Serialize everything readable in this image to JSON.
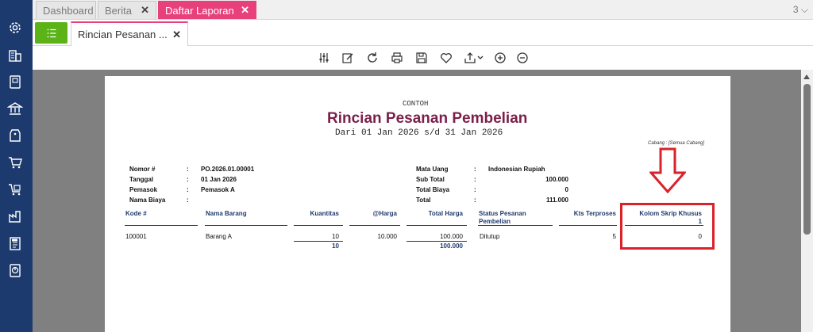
{
  "tabs": [
    {
      "label": "Dashboard",
      "closable": false
    },
    {
      "label": "Berita",
      "closable": true
    },
    {
      "label": "Daftar Laporan",
      "closable": true
    }
  ],
  "tab_count": "3",
  "document_tab": {
    "label": "Rincian Pesanan ..."
  },
  "sidebar_icons": [
    "gear-icon",
    "building-icon",
    "book-icon",
    "bank-icon",
    "price-tag-icon",
    "cart-icon",
    "cart-box-icon",
    "factory-icon",
    "tax-document-icon",
    "report-icon"
  ],
  "toolbar_icons": [
    "sliders-icon",
    "edit-icon",
    "refresh-icon",
    "print-icon",
    "save-icon",
    "favorite-icon",
    "export-icon",
    "zoom-in-icon",
    "zoom-out-icon"
  ],
  "report": {
    "watermark": "CONTOH",
    "title": "Rincian Pesanan Pembelian",
    "period": "Dari 01 Jan 2026 s/d 31 Jan 2026",
    "branch": "Cabang : [Semua Cabang]",
    "left_fields": [
      {
        "label": "Nomor #",
        "sep": ":",
        "value": "PO.2026.01.00001"
      },
      {
        "label": "Tanggal",
        "sep": ":",
        "value": "01 Jan 2026"
      },
      {
        "label": "Pemasok",
        "sep": ":",
        "value": "Pemasok A"
      },
      {
        "label": "Nama Biaya",
        "sep": ":",
        "value": ""
      }
    ],
    "right_fields": [
      {
        "label": "Mata Uang",
        "sep": ":",
        "value": "Indonesian Rupiah"
      },
      {
        "label": "Sub Total",
        "sep": ":",
        "value": "100.000"
      },
      {
        "label": "Total Biaya",
        "sep": ":",
        "value": "0"
      },
      {
        "label": "Total",
        "sep": ":",
        "value": "111.000"
      }
    ],
    "columns": {
      "kode": "Kode #",
      "nama_barang": "Nama Barang",
      "kuantitas": "Kuantitas",
      "harga": "@Harga",
      "total_harga": "Total Harga",
      "status_line1": "Status Pesanan",
      "status_line2": "Pembelian",
      "kts_terproses": "Kts Terproses",
      "skrip_khusus": "Kolom Skrip Khusus",
      "skrip_khusus_sub": "1"
    },
    "rows": [
      {
        "kode": "100001",
        "nama_barang": "Barang A",
        "kuantitas": "10",
        "harga": "10.000",
        "total_harga": "100.000",
        "status": "Ditutup",
        "kts_terproses": "5",
        "skrip_khusus": "0"
      }
    ],
    "totals": {
      "kuantitas": "10",
      "total_harga": "100.000"
    }
  },
  "annotation": {
    "highlight_color": "#d9222a"
  },
  "colors": {
    "sidebar": "#1d3a6e",
    "active_tab": "#e8407a",
    "menu_button": "#5bb318",
    "title": "#7b1f4a",
    "column_header": "#1f3b6e"
  }
}
